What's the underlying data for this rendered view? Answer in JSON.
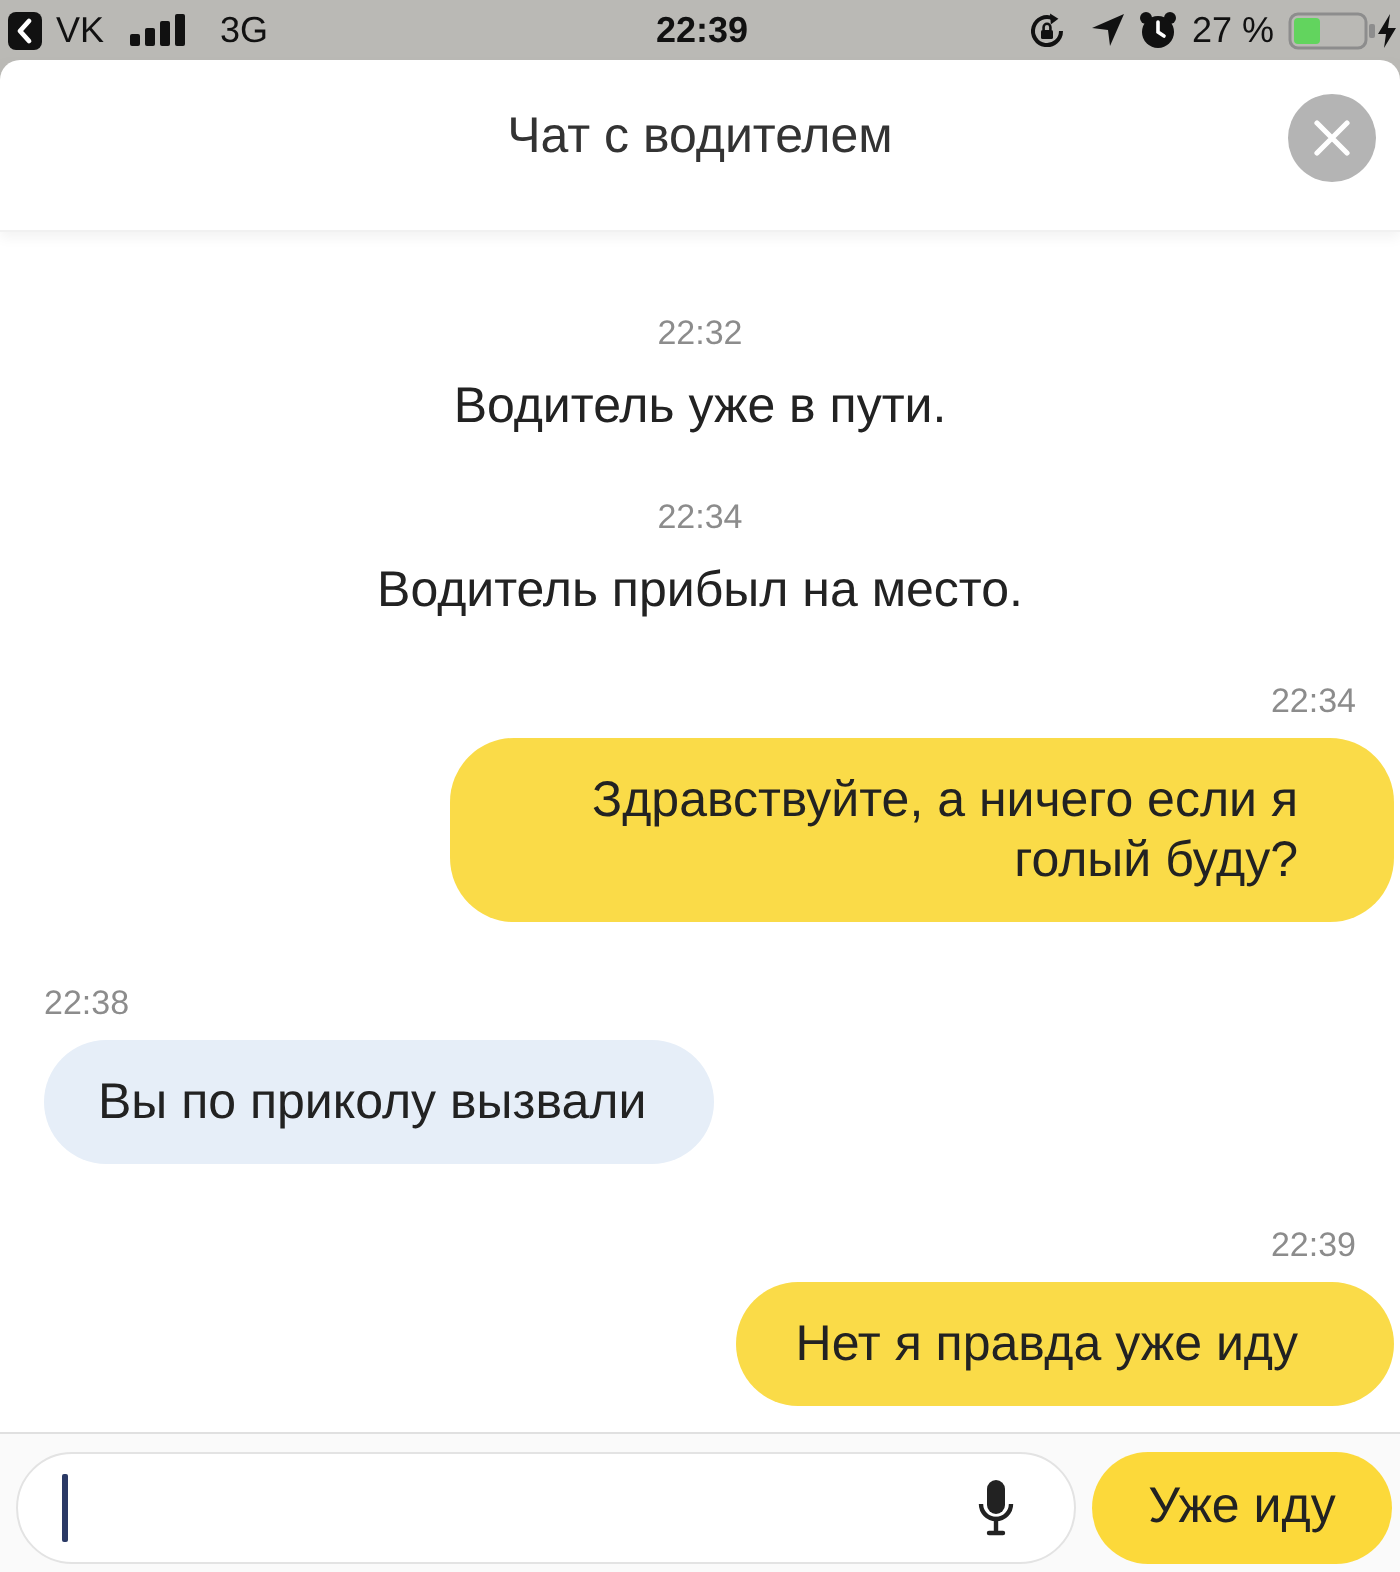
{
  "status_bar": {
    "back_label": "VK",
    "network": "3G",
    "time": "22:39",
    "battery": "27 %"
  },
  "header": {
    "title": "Чат с водителем"
  },
  "messages": [
    {
      "kind": "system",
      "time": "22:32",
      "text": "Водитель уже в пути."
    },
    {
      "kind": "system",
      "time": "22:34",
      "text": "Водитель прибыл на место."
    },
    {
      "kind": "outgoing",
      "time": "22:34",
      "text": "Здравствуйте, а ничего если я голый буду?"
    },
    {
      "kind": "incoming",
      "time": "22:38",
      "text": "Вы по приколу вызвали"
    },
    {
      "kind": "outgoing",
      "time": "22:39",
      "text": "Нет я правда уже иду"
    }
  ],
  "composer": {
    "quick_reply": "Уже иду"
  }
}
